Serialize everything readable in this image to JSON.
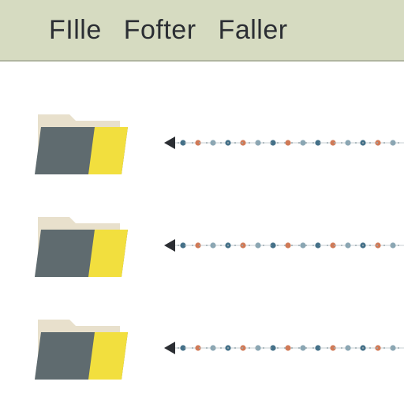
{
  "header": {
    "word1": "FIlle",
    "word2": "Fofter",
    "word3": "Faller"
  },
  "colors": {
    "folder_back": "#e8e0cc",
    "folder_front": "#5f6b6f",
    "folder_accent": "#f2df3e",
    "marker": "#2b2e33",
    "dot_a": "#447088",
    "dot_b": "#d07a57",
    "dot_c": "#8aa6b3"
  },
  "rows": 3
}
